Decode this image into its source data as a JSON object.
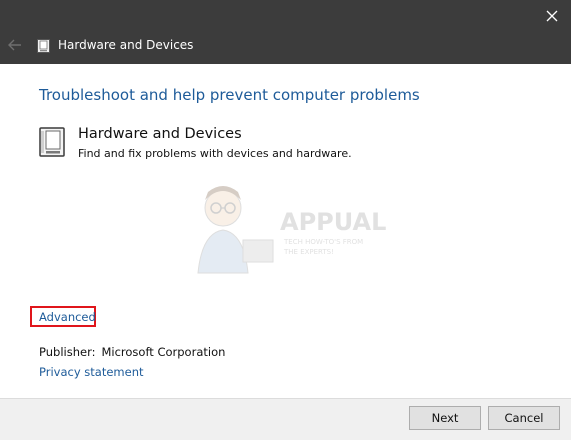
{
  "titlebar": {
    "title": "Hardware and Devices",
    "back_icon": "back-arrow-icon",
    "close_icon": "close-icon"
  },
  "main": {
    "heading": "Troubleshoot and help prevent computer problems",
    "item": {
      "icon": "hardware-device-icon",
      "title": "Hardware and Devices",
      "description": "Find and fix problems with devices and hardware."
    },
    "watermark": {
      "text": "APPUALS",
      "tagline_line1": "TECH HOW-TO'S FROM",
      "tagline_line2": "THE EXPERTS!"
    },
    "advanced_label": "Advanced",
    "publisher_label": "Publisher:",
    "publisher_value": "Microsoft Corporation",
    "privacy_label": "Privacy statement"
  },
  "footer": {
    "next_label": "Next",
    "cancel_label": "Cancel"
  },
  "colors": {
    "titlebar": "#3c3c3c",
    "link": "#1e5b99",
    "highlight_box": "#e0151b",
    "footer": "#f0f0f0"
  }
}
